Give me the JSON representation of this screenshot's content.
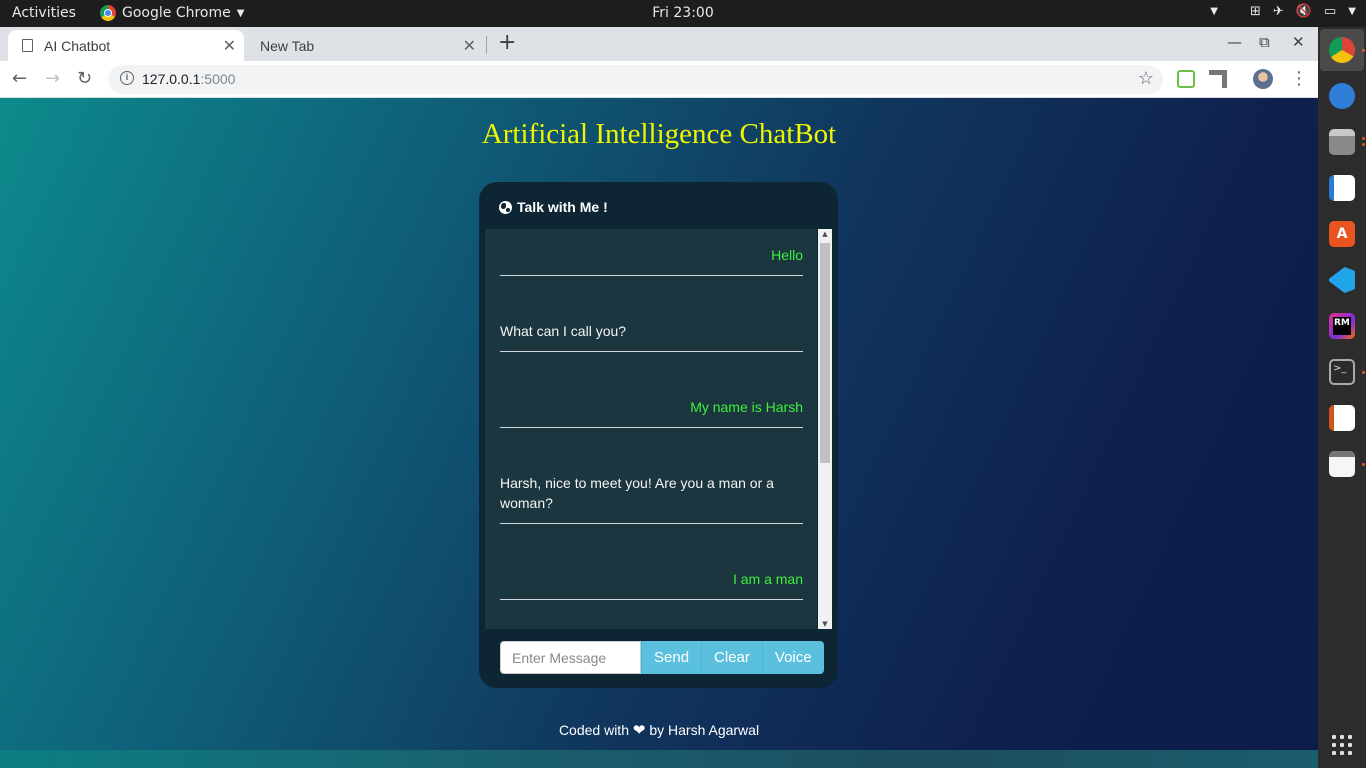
{
  "topbar": {
    "activities": "Activities",
    "app_name": "Google Chrome",
    "clock": "Fri 23:00"
  },
  "browser": {
    "tabs": [
      {
        "label": "AI Chatbot",
        "active": true
      },
      {
        "label": "New Tab",
        "active": false
      }
    ],
    "url_host": "127.0.0.1",
    "url_port": ":5000"
  },
  "page": {
    "title": "Artificial Intelligence ChatBot",
    "chat_header": "Talk with Me !",
    "messages": [
      {
        "sender": "user",
        "text": "Hello"
      },
      {
        "sender": "bot",
        "text": "What can I call you?"
      },
      {
        "sender": "user",
        "text": "My name is Harsh"
      },
      {
        "sender": "bot",
        "text": "Harsh, nice to meet you! Are you a man or a woman?"
      },
      {
        "sender": "user",
        "text": "I am a man"
      }
    ],
    "input_placeholder": "Enter Message",
    "buttons": {
      "send": "Send",
      "clear": "Clear",
      "voice": "Voice"
    },
    "footer_before": "Coded with",
    "footer_after": "by Harsh Agarwal"
  },
  "colors": {
    "title": "#f0f500",
    "user_message": "#3cf13c",
    "button": "#5bc0de"
  },
  "dock": {
    "icons": [
      "chrome-icon",
      "thunderbird-icon",
      "files-icon",
      "writer-icon",
      "software-icon",
      "vscode-icon",
      "rubymine-icon",
      "terminal-icon",
      "impress-icon",
      "text-editor-icon"
    ]
  }
}
